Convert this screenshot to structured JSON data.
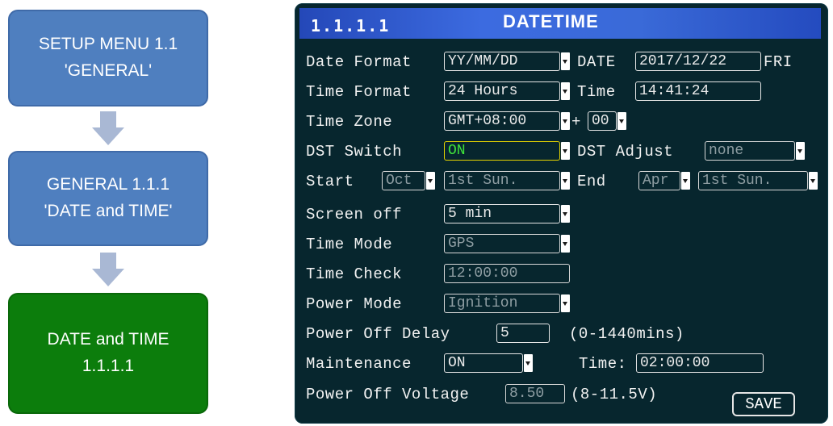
{
  "flow": {
    "step1_line1": "SETUP MENU 1.1",
    "step1_line2": "'GENERAL'",
    "step2_line1": "GENERAL 1.1.1",
    "step2_line2": "'DATE and TIME'",
    "step3_line1": "DATE and TIME",
    "step3_line2": "1.1.1.1"
  },
  "colors": {
    "flow_blue": "#4f7fbf",
    "flow_green": "#0c7d0c",
    "screen_bg": "#07262e",
    "header_blue": "#3c6be0",
    "active_text": "#3fe23a",
    "active_border": "#e6d400"
  },
  "screen": {
    "menu_code": "1.1.1.1",
    "title": "DATETIME"
  },
  "form": {
    "date_format_label": "Date Format",
    "date_format_value": "YY/MM/DD",
    "date_label": "DATE",
    "date_value": "2017/12/22",
    "day_of_week": "FRI",
    "time_format_label": "Time Format",
    "time_format_value": "24 Hours",
    "time_label": "Time",
    "time_value": "14:41:24",
    "time_zone_label": "Time Zone",
    "time_zone_value": "GMT+08:00",
    "tz_plus": "+",
    "tz_offset_value": "00",
    "dst_switch_label": "DST Switch",
    "dst_switch_value": "ON",
    "dst_adjust_label": "DST Adjust",
    "dst_adjust_value": "none",
    "start_label": "Start",
    "start_month": "Oct",
    "start_week": "1st Sun.",
    "end_label": "End",
    "end_month": "Apr",
    "end_week": "1st Sun.",
    "screen_off_label": "Screen off",
    "screen_off_value": "5 min",
    "time_mode_label": "Time Mode",
    "time_mode_value": "GPS",
    "time_check_label": "Time Check",
    "time_check_value": "12:00:00",
    "power_mode_label": "Power Mode",
    "power_mode_value": "Ignition",
    "power_off_delay_label": "Power Off Delay",
    "power_off_delay_value": "5",
    "power_off_delay_range": "(0-1440mins)",
    "maintenance_label": "Maintenance",
    "maintenance_value": "ON",
    "maintenance_time_label": "Time:",
    "maintenance_time_value": "02:00:00",
    "power_off_voltage_label": "Power Off Voltage",
    "power_off_voltage_value": "8.50",
    "power_off_voltage_range": "(8-11.5V)",
    "save_label": "SAVE"
  },
  "icons": {
    "dropdown": "dropdown-arrow-icon",
    "flow_arrow": "down-arrow-icon"
  }
}
